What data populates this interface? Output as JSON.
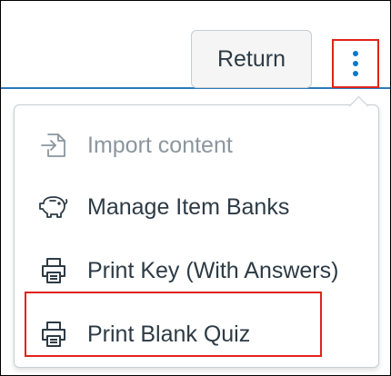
{
  "toolbar": {
    "return_label": "Return"
  },
  "menu": {
    "items": [
      {
        "label": "Import content",
        "icon": "import-icon",
        "disabled": true
      },
      {
        "label": "Manage Item Banks",
        "icon": "piggy-bank-icon",
        "disabled": false
      },
      {
        "label": "Print Key (With Answers)",
        "icon": "printer-icon",
        "disabled": false
      },
      {
        "label": "Print Blank Quiz",
        "icon": "printer-icon",
        "disabled": false,
        "highlighted": true
      }
    ]
  },
  "colors": {
    "accent": "#0b79c9",
    "highlight": "#e0231b",
    "text": "#2d3b45",
    "disabled_text": "#8b969e"
  }
}
